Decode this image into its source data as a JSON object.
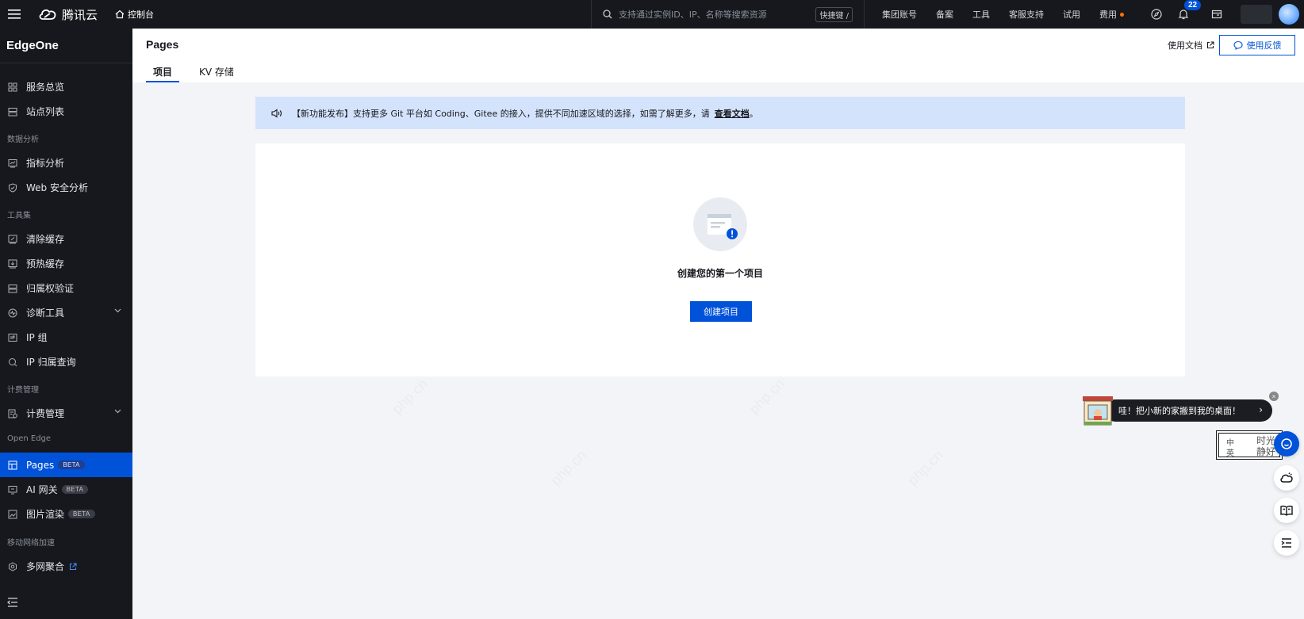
{
  "topbar": {
    "brand": "腾讯云",
    "console": "控制台",
    "search_placeholder": "支持通过实例ID、IP、名称等搜索资源",
    "shortcut": "快捷键 /",
    "links": [
      "集团账号",
      "备案",
      "工具",
      "客服支持",
      "试用"
    ],
    "fee": "费用",
    "notification_count": "22"
  },
  "sidebar": {
    "title": "EdgeOne",
    "items": [
      {
        "label": "服务总览",
        "icon": "grid-icon"
      },
      {
        "label": "站点列表",
        "icon": "list-icon"
      },
      {
        "label": "指标分析",
        "icon": "chart-icon"
      },
      {
        "label": "Web 安全分析",
        "icon": "shield-icon"
      },
      {
        "label": "清除缓存",
        "icon": "purge-icon"
      },
      {
        "label": "预热缓存",
        "icon": "prefetch-icon"
      },
      {
        "label": "归属权验证",
        "icon": "verify-icon"
      },
      {
        "label": "诊断工具",
        "icon": "diagnose-icon"
      },
      {
        "label": "IP 组",
        "icon": "ip-icon"
      },
      {
        "label": "IP 归属查询",
        "icon": "search-icon"
      },
      {
        "label": "计费管理",
        "icon": "billing-icon"
      },
      {
        "label": "Pages",
        "icon": "pages-icon",
        "badge": "BETA"
      },
      {
        "label": "AI 网关",
        "icon": "ai-icon",
        "badge": "BETA"
      },
      {
        "label": "图片渲染",
        "icon": "image-icon",
        "badge": "BETA"
      },
      {
        "label": "多网聚合",
        "icon": "network-icon"
      }
    ],
    "groups": [
      "数据分析",
      "工具集",
      "计费管理",
      "Open Edge",
      "移动网络加速"
    ]
  },
  "page": {
    "title": "Pages",
    "tabs": [
      "项目",
      "KV 存储"
    ],
    "doc_link": "使用文档",
    "feedback": "使用反馈"
  },
  "notice": {
    "tag": "【新功能发布】",
    "text": "支持更多 Git 平台如 Coding、Gitee 的接入，提供不同加速区域的选择，如需了解更多，请",
    "link": "查看文档",
    "end": "。"
  },
  "empty": {
    "text": "创建您的第一个项目",
    "button": "创建项目"
  },
  "promo": {
    "text": "哇！把小新的家搬到我的桌面！",
    "close": "×",
    "arrow": "›"
  },
  "ime": {
    "a": "中",
    "b": "英",
    "c": "时光",
    "d": "静好"
  },
  "colors": {
    "brand": "#0052d9",
    "topbar": "#16181d",
    "notice_bg": "#d4e3fc"
  }
}
